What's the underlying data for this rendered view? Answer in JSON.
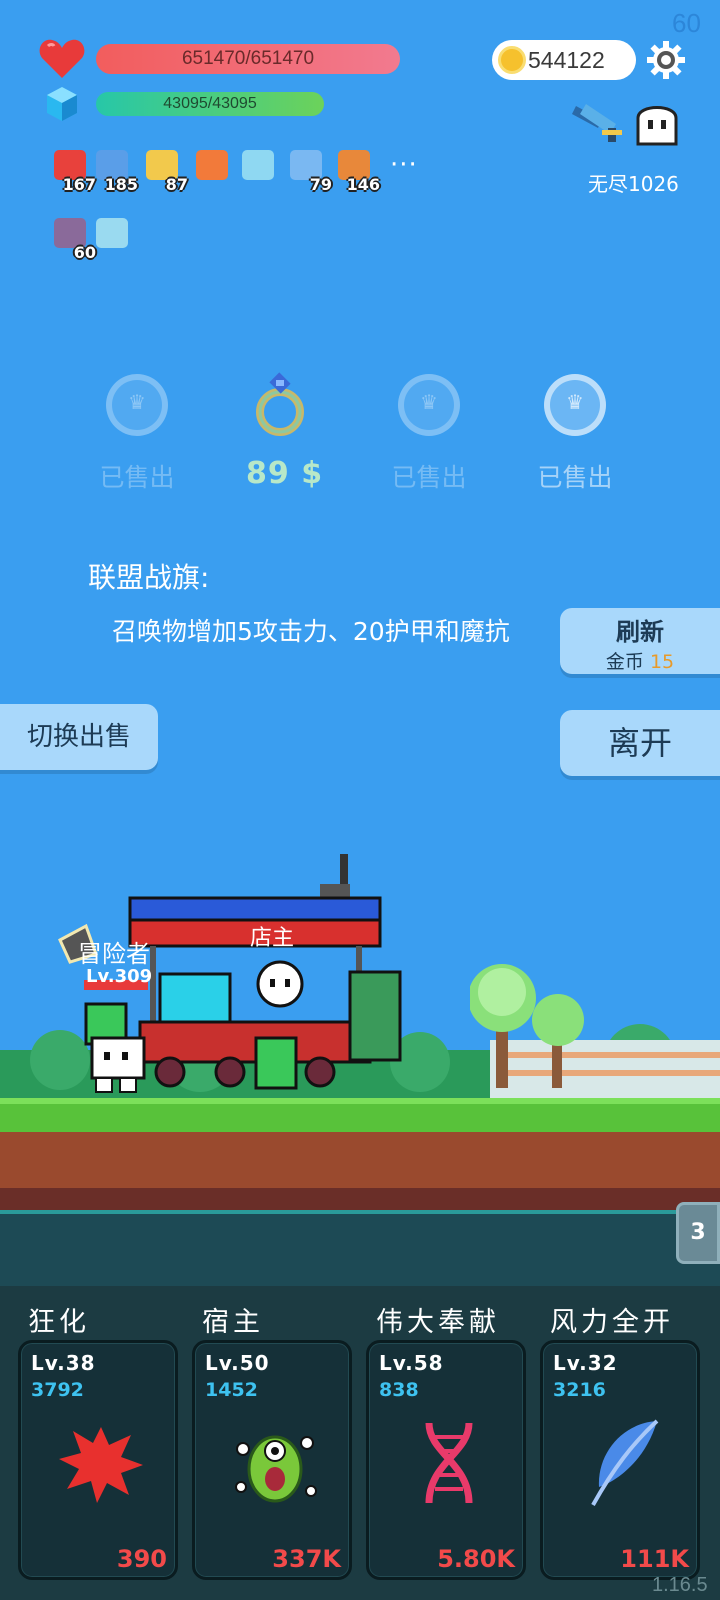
{
  "fps": "60",
  "hud": {
    "hp_text": "651470/651470",
    "mp_text": "43095/43095",
    "coins": "544122",
    "endless_label": "无尽1026"
  },
  "buffs": [
    {
      "icon": "watermelon-icon",
      "count": "167",
      "color": "#e8413c"
    },
    {
      "icon": "star-card-icon",
      "count": "185",
      "color": "#5a9ee8"
    },
    {
      "icon": "crown-icon",
      "count": "87",
      "color": "#f2c94c"
    },
    {
      "icon": "torch-icon",
      "count": "",
      "color": "#f27a3a"
    },
    {
      "icon": "magnifier-icon",
      "count": "",
      "color": "#8fd8f2"
    },
    {
      "icon": "potion-icon",
      "count": "79",
      "color": "#7ab8f2"
    },
    {
      "icon": "book-icon",
      "count": "146",
      "color": "#e8883a"
    },
    {
      "icon": "sword-card-icon",
      "count": "60",
      "color": "#8a6a9a"
    },
    {
      "icon": "glow-card-icon",
      "count": "",
      "color": "#9adaf0"
    }
  ],
  "more_label": "···",
  "shop": {
    "items": [
      {
        "label": "已售出"
      },
      {
        "label": "89 $"
      },
      {
        "label": "已售出"
      },
      {
        "label": "已售出"
      }
    ],
    "title": "联盟战旗:",
    "description": "召唤物增加5攻击力、20护甲和魔抗"
  },
  "buttons": {
    "refresh": "刷新",
    "refresh_cost_label": "金币",
    "refresh_cost": "15",
    "switch_sell": "切换出售",
    "leave": "离开"
  },
  "scene": {
    "merchant_label": "店主",
    "hero_label": "冒险者",
    "hero_level": "Lv.309",
    "wave": "3"
  },
  "skills": [
    {
      "name": "狂化",
      "level": "Lv.38",
      "value": "3792",
      "cost": "390",
      "icon": "splat-icon",
      "color": "#e8302e"
    },
    {
      "name": "宿主",
      "level": "Lv.50",
      "value": "1452",
      "cost": "337K",
      "icon": "germ-icon",
      "color": "#7ac83a"
    },
    {
      "name": "伟大奉献",
      "level": "Lv.58",
      "value": "838",
      "cost": "5.80K",
      "icon": "dna-icon",
      "color": "#e83a6a"
    },
    {
      "name": "风力全开",
      "level": "Lv.32",
      "value": "3216",
      "cost": "111K",
      "icon": "feather-icon",
      "color": "#4a8ae8"
    }
  ],
  "version": "1.16.5"
}
